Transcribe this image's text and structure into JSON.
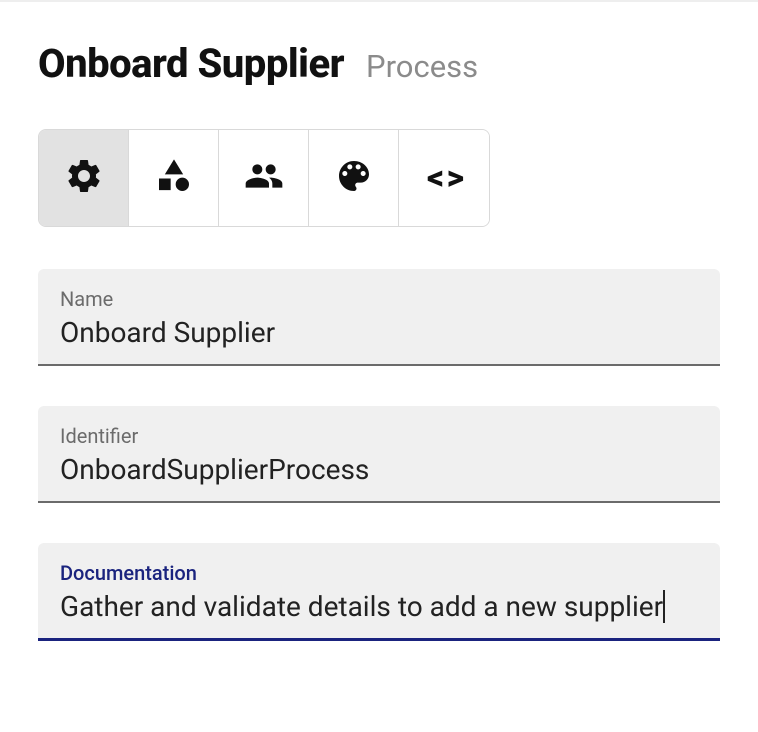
{
  "header": {
    "title": "Onboard Supplier",
    "subtitle": "Process"
  },
  "tabs": {
    "settings": "settings-icon",
    "shapes": "shapes-icon",
    "people": "people-icon",
    "palette": "palette-icon",
    "code": "< >"
  },
  "fields": {
    "name": {
      "label": "Name",
      "value": "Onboard Supplier"
    },
    "identifier": {
      "label": "Identifier",
      "value": "OnboardSupplierProcess"
    },
    "documentation": {
      "label": "Documentation",
      "value": "Gather and validate details to add a new supplier"
    }
  }
}
